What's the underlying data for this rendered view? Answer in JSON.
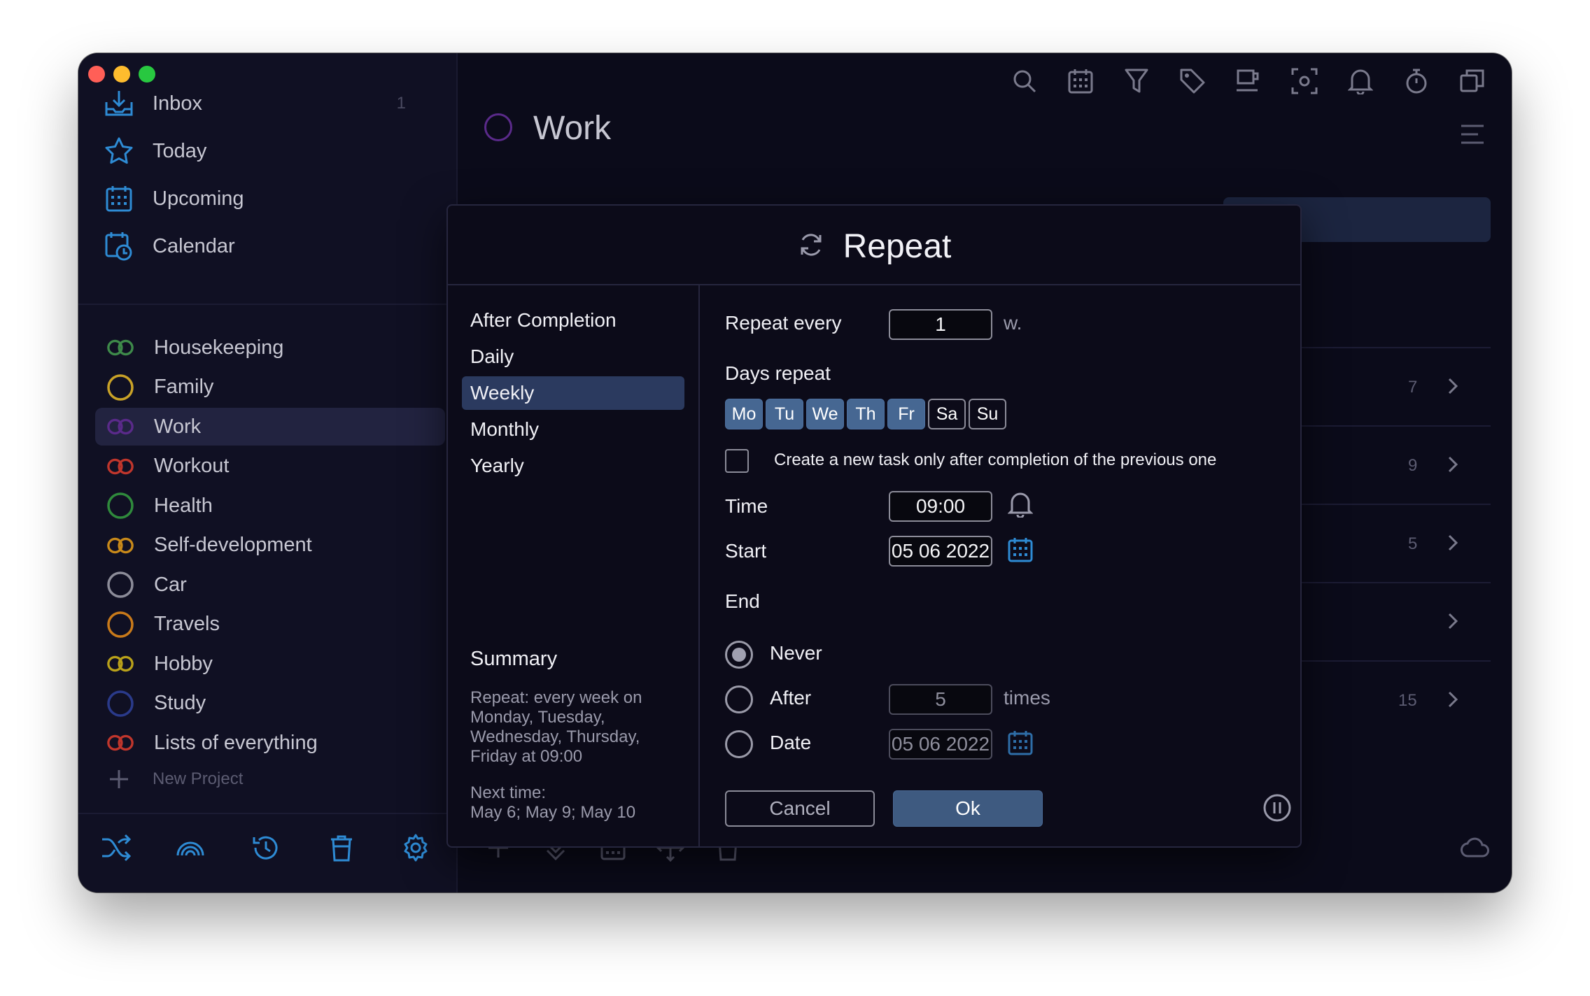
{
  "sidebar": {
    "nav": [
      {
        "label": "Inbox",
        "icon": "inbox-icon",
        "count": "1"
      },
      {
        "label": "Today",
        "icon": "star-icon",
        "count": ""
      },
      {
        "label": "Upcoming",
        "icon": "calendar-grid-icon",
        "count": ""
      },
      {
        "label": "Calendar",
        "icon": "calendar-clock-icon",
        "count": ""
      }
    ],
    "projects": [
      {
        "label": "Housekeeping",
        "color": "#3e8a4a",
        "type": "double"
      },
      {
        "label": "Family",
        "color": "#c9a227",
        "type": "single"
      },
      {
        "label": "Work",
        "color": "#5a2a8a",
        "type": "double"
      },
      {
        "label": "Workout",
        "color": "#c0362c",
        "type": "double"
      },
      {
        "label": "Health",
        "color": "#2f8a3c",
        "type": "single"
      },
      {
        "label": "Self-development",
        "color": "#c98a1a",
        "type": "double"
      },
      {
        "label": "Car",
        "color": "#8c8c99",
        "type": "single"
      },
      {
        "label": "Travels",
        "color": "#c97a1a",
        "type": "single"
      },
      {
        "label": "Hobby",
        "color": "#b9a11a",
        "type": "double"
      },
      {
        "label": "Study",
        "color": "#2a3a8a",
        "type": "single"
      },
      {
        "label": "Lists of everything",
        "color": "#c0362c",
        "type": "double"
      }
    ],
    "new_project": "New Project"
  },
  "main": {
    "title": "Work",
    "rows": [
      {
        "count": "7"
      },
      {
        "count": "9"
      },
      {
        "count": "5"
      },
      {
        "count": ""
      },
      {
        "count": "15"
      }
    ]
  },
  "dialog": {
    "title": "Repeat",
    "frequencies": [
      "After Completion",
      "Daily",
      "Weekly",
      "Monthly",
      "Yearly"
    ],
    "selected_frequency": "Weekly",
    "summary_title": "Summary",
    "summary_text": "Repeat: every week on Monday, Tuesday, Wednesday, Thursday, Friday at 09:00",
    "next_label": "Next time:",
    "next_value": "May 6; May 9; May 10",
    "repeat_every_label": "Repeat every",
    "repeat_every_value": "1",
    "repeat_unit": "w.",
    "days_label": "Days repeat",
    "days": [
      {
        "label": "Mo",
        "on": true
      },
      {
        "label": "Tu",
        "on": true
      },
      {
        "label": "We",
        "on": true
      },
      {
        "label": "Th",
        "on": true
      },
      {
        "label": "Fr",
        "on": true
      },
      {
        "label": "Sa",
        "on": false
      },
      {
        "label": "Su",
        "on": false
      }
    ],
    "checkbox_label": "Create a new task only after completion of the previous one",
    "time_label": "Time",
    "time_value": "09:00",
    "start_label": "Start",
    "start_value": "05 06 2022",
    "end_label": "End",
    "end_never": "Never",
    "end_after": "After",
    "end_after_value": "5",
    "end_after_unit": "times",
    "end_date": "Date",
    "end_date_value": "05 06 2022",
    "cancel": "Cancel",
    "ok": "Ok"
  },
  "colors": {
    "accent": "#466792",
    "ok_button": "#3e5a80",
    "icon_blue": "#2e8bd4"
  }
}
